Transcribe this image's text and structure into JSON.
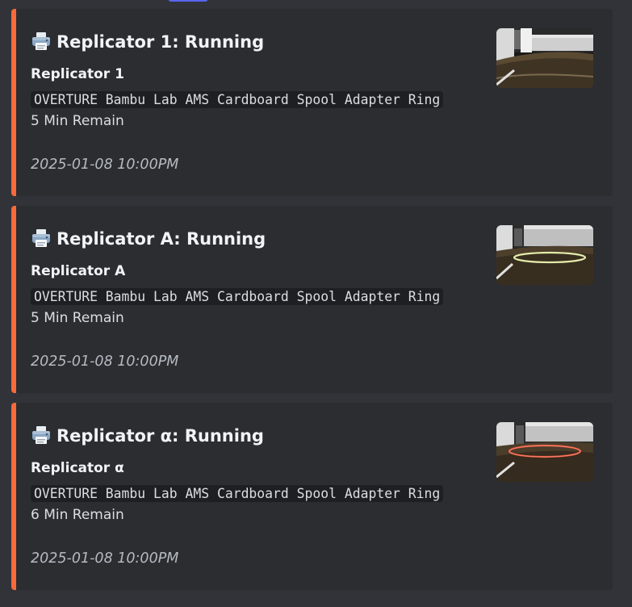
{
  "messages": [
    {
      "title": "Replicator 1: Running",
      "icon": "printer-icon",
      "printer_name": "Replicator 1",
      "job_name": "OVERTURE Bambu Lab AMS Cardboard Spool Adapter Ring",
      "remaining": "5 Min Remain",
      "timestamp": "2025-01-08 10:00PM",
      "snapshot_ring_color": "none"
    },
    {
      "title": "Replicator A: Running",
      "icon": "printer-icon",
      "printer_name": "Replicator A",
      "job_name": "OVERTURE Bambu Lab AMS Cardboard Spool Adapter Ring",
      "remaining": "5 Min Remain",
      "timestamp": "2025-01-08 10:00PM",
      "snapshot_ring_color": "#d8e39a"
    },
    {
      "title": "Replicator α: Running",
      "icon": "printer-icon",
      "printer_name": "Replicator α",
      "job_name": "OVERTURE Bambu Lab AMS Cardboard Spool Adapter Ring",
      "remaining": "6 Min Remain",
      "timestamp": "2025-01-08 10:00PM",
      "snapshot_ring_color": "#e0533c"
    }
  ],
  "colors": {
    "embed_accent": "#f76a3a",
    "embed_background": "#2b2d31",
    "chat_background": "#313338"
  }
}
